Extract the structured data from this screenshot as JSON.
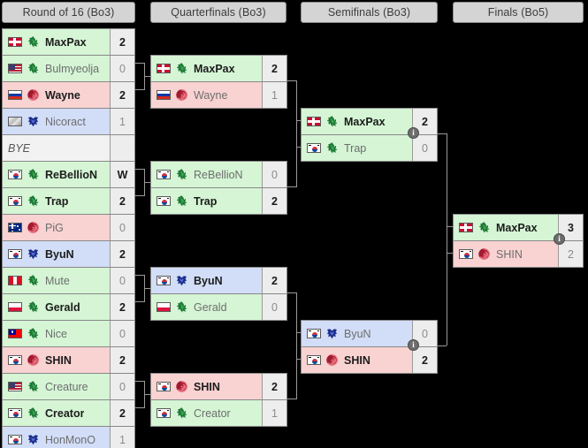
{
  "tournament": {
    "background_color": "#000000",
    "header_color": "#d4d4d4",
    "line_color": "#9a9a9a"
  },
  "race_colors": {
    "protoss": "#d5f5d5",
    "zerg": "#f9d2d2",
    "terran": "#d2ddf7",
    "none": "#f2f2f2"
  },
  "rounds": [
    {
      "id": "ro16",
      "label": "Round of 16 (Bo3)"
    },
    {
      "id": "qf",
      "label": "Quarterfinals (Bo3)"
    },
    {
      "id": "sf",
      "label": "Semifinals (Bo3)"
    },
    {
      "id": "f",
      "label": "Finals (Bo5)"
    }
  ],
  "matches": {
    "ro16_1": {
      "top": {
        "name": "MaxPax",
        "score": "2",
        "race": "protoss",
        "flag": "denmark",
        "winner": true
      },
      "bottom": {
        "name": "Bulmyeolja",
        "score": "0",
        "race": "protoss",
        "flag": "usa",
        "winner": false
      }
    },
    "ro16_2": {
      "top": {
        "name": "Wayne",
        "score": "2",
        "race": "zerg",
        "flag": "russia",
        "winner": true
      },
      "bottom": {
        "name": "Nicoract",
        "score": "1",
        "race": "terran",
        "flag": "neutral",
        "winner": false
      }
    },
    "ro16_3": {
      "top": {
        "name": "BYE",
        "score": "",
        "race": "none",
        "flag": "none",
        "winner": false,
        "bye": true
      },
      "bottom": {
        "name": "ReBellioN",
        "score": "W",
        "race": "protoss",
        "flag": "southkorea",
        "winner": true
      }
    },
    "ro16_4": {
      "top": {
        "name": "Trap",
        "score": "2",
        "race": "protoss",
        "flag": "southkorea",
        "winner": true
      },
      "bottom": {
        "name": "PiG",
        "score": "0",
        "race": "zerg",
        "flag": "australia",
        "winner": false
      }
    },
    "ro16_5": {
      "top": {
        "name": "ByuN",
        "score": "2",
        "race": "terran",
        "flag": "southkorea",
        "winner": true
      },
      "bottom": {
        "name": "Mute",
        "score": "0",
        "race": "protoss",
        "flag": "peru",
        "winner": false
      }
    },
    "ro16_6": {
      "top": {
        "name": "Gerald",
        "score": "2",
        "race": "protoss",
        "flag": "poland",
        "winner": true
      },
      "bottom": {
        "name": "Nice",
        "score": "0",
        "race": "protoss",
        "flag": "taiwan",
        "winner": false
      }
    },
    "ro16_7": {
      "top": {
        "name": "SHIN",
        "score": "2",
        "race": "zerg",
        "flag": "southkorea",
        "winner": true
      },
      "bottom": {
        "name": "Creature",
        "score": "0",
        "race": "protoss",
        "flag": "usa",
        "winner": false
      }
    },
    "ro16_8": {
      "top": {
        "name": "Creator",
        "score": "2",
        "race": "protoss",
        "flag": "southkorea",
        "winner": true
      },
      "bottom": {
        "name": "HonMonO",
        "score": "1",
        "race": "terran",
        "flag": "southkorea",
        "winner": false
      }
    },
    "qf_1": {
      "top": {
        "name": "MaxPax",
        "score": "2",
        "race": "protoss",
        "flag": "denmark",
        "winner": true
      },
      "bottom": {
        "name": "Wayne",
        "score": "1",
        "race": "zerg",
        "flag": "russia",
        "winner": false
      }
    },
    "qf_2": {
      "top": {
        "name": "ReBellioN",
        "score": "0",
        "race": "protoss",
        "flag": "southkorea",
        "winner": false
      },
      "bottom": {
        "name": "Trap",
        "score": "2",
        "race": "protoss",
        "flag": "southkorea",
        "winner": true
      }
    },
    "qf_3": {
      "top": {
        "name": "ByuN",
        "score": "2",
        "race": "terran",
        "flag": "southkorea",
        "winner": true
      },
      "bottom": {
        "name": "Gerald",
        "score": "0",
        "race": "protoss",
        "flag": "poland",
        "winner": false
      }
    },
    "qf_4": {
      "top": {
        "name": "SHIN",
        "score": "2",
        "race": "zerg",
        "flag": "southkorea",
        "winner": true
      },
      "bottom": {
        "name": "Creator",
        "score": "1",
        "race": "protoss",
        "flag": "southkorea",
        "winner": false
      }
    },
    "sf_1": {
      "top": {
        "name": "MaxPax",
        "score": "2",
        "race": "protoss",
        "flag": "denmark",
        "winner": true
      },
      "bottom": {
        "name": "Trap",
        "score": "0",
        "race": "protoss",
        "flag": "southkorea",
        "winner": false
      },
      "info": "i"
    },
    "sf_2": {
      "top": {
        "name": "ByuN",
        "score": "0",
        "race": "terran",
        "flag": "southkorea",
        "winner": false
      },
      "bottom": {
        "name": "SHIN",
        "score": "2",
        "race": "zerg",
        "flag": "southkorea",
        "winner": true
      },
      "info": "i"
    },
    "final": {
      "top": {
        "name": "MaxPax",
        "score": "3",
        "race": "protoss",
        "flag": "denmark",
        "winner": true
      },
      "bottom": {
        "name": "SHIN",
        "score": "2",
        "race": "zerg",
        "flag": "southkorea",
        "winner": false
      },
      "info": "i"
    }
  }
}
